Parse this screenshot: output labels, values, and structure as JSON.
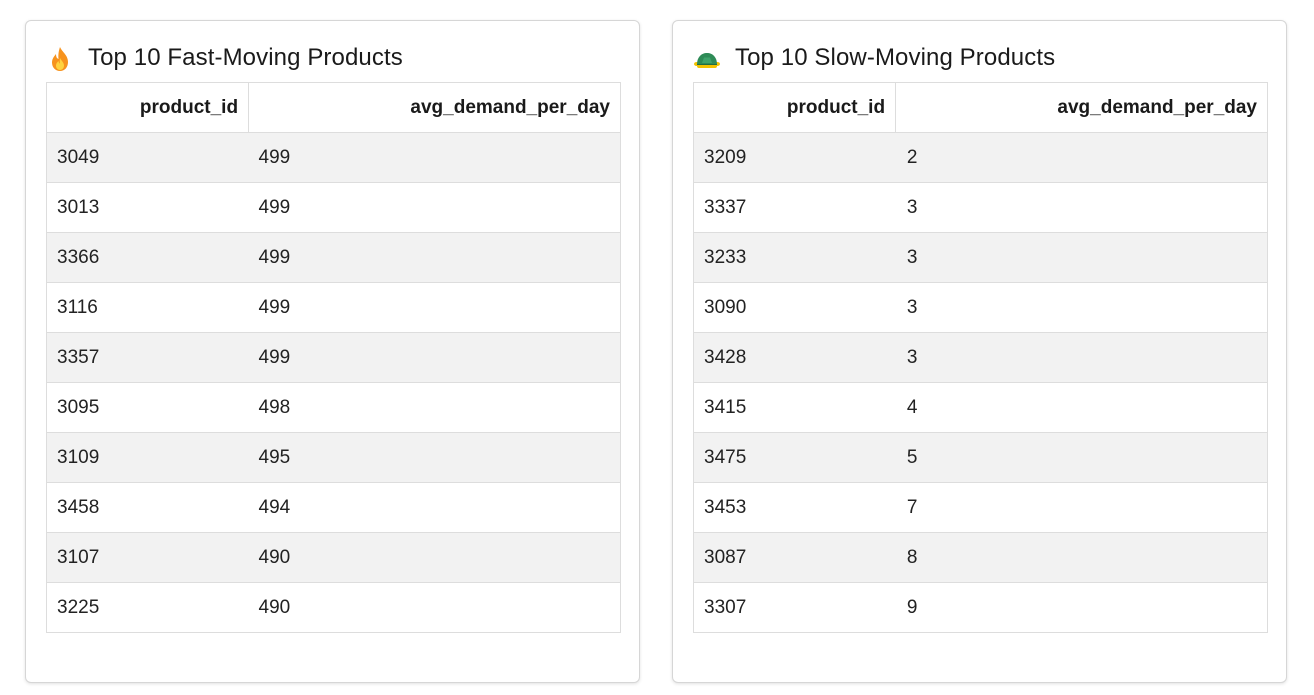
{
  "fast_moving": {
    "icon": "fire-icon",
    "title": "Top 10 Fast-Moving Products",
    "columns": [
      "product_id",
      "avg_demand_per_day"
    ],
    "rows": [
      {
        "product_id": "3049",
        "avg_demand_per_day": "499"
      },
      {
        "product_id": "3013",
        "avg_demand_per_day": "499"
      },
      {
        "product_id": "3366",
        "avg_demand_per_day": "499"
      },
      {
        "product_id": "3116",
        "avg_demand_per_day": "499"
      },
      {
        "product_id": "3357",
        "avg_demand_per_day": "499"
      },
      {
        "product_id": "3095",
        "avg_demand_per_day": "498"
      },
      {
        "product_id": "3109",
        "avg_demand_per_day": "495"
      },
      {
        "product_id": "3458",
        "avg_demand_per_day": "494"
      },
      {
        "product_id": "3107",
        "avg_demand_per_day": "490"
      },
      {
        "product_id": "3225",
        "avg_demand_per_day": "490"
      }
    ]
  },
  "slow_moving": {
    "icon": "turtle-icon",
    "title": "Top 10 Slow-Moving Products",
    "columns": [
      "product_id",
      "avg_demand_per_day"
    ],
    "rows": [
      {
        "product_id": "3209",
        "avg_demand_per_day": "2"
      },
      {
        "product_id": "3337",
        "avg_demand_per_day": "3"
      },
      {
        "product_id": "3233",
        "avg_demand_per_day": "3"
      },
      {
        "product_id": "3090",
        "avg_demand_per_day": "3"
      },
      {
        "product_id": "3428",
        "avg_demand_per_day": "3"
      },
      {
        "product_id": "3415",
        "avg_demand_per_day": "4"
      },
      {
        "product_id": "3475",
        "avg_demand_per_day": "5"
      },
      {
        "product_id": "3453",
        "avg_demand_per_day": "7"
      },
      {
        "product_id": "3087",
        "avg_demand_per_day": "8"
      },
      {
        "product_id": "3307",
        "avg_demand_per_day": "9"
      }
    ]
  },
  "colors": {
    "stripe_row": "#f2f2f2",
    "border": "#dddddd",
    "card_border": "#d6d6d6",
    "fire_outer": "#f7931e",
    "fire_inner": "#ffd23f",
    "turtle_shell": "#2e8b57",
    "turtle_body": "#f2c200"
  }
}
